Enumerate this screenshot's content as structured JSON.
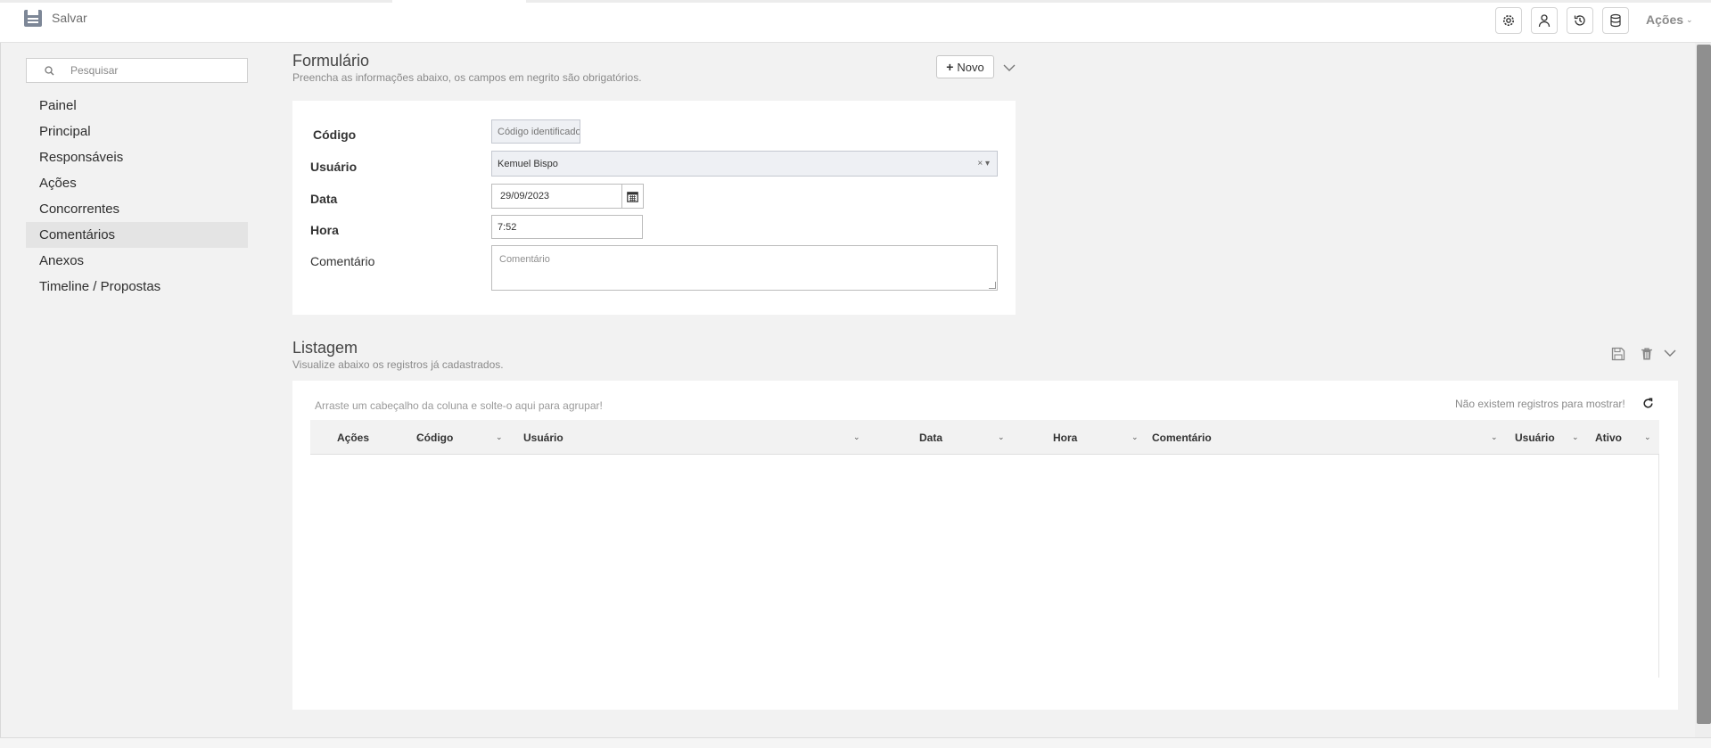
{
  "toolbar": {
    "save_label": "Salvar",
    "actions_label": "Ações",
    "icons": [
      "gear-icon",
      "user-icon",
      "history-icon",
      "database-icon"
    ]
  },
  "sidebar": {
    "search_placeholder": "Pesquisar",
    "items": [
      {
        "label": "Painel"
      },
      {
        "label": "Principal"
      },
      {
        "label": "Responsáveis"
      },
      {
        "label": "Ações"
      },
      {
        "label": "Concorrentes"
      },
      {
        "label": "Comentários",
        "active": true
      },
      {
        "label": "Anexos"
      },
      {
        "label": "Timeline / Propostas"
      }
    ]
  },
  "form": {
    "title": "Formulário",
    "subtitle": "Preencha as informações abaixo, os campos em negrito são obrigatórios.",
    "new_label": "Novo",
    "fields": {
      "codigo": {
        "label": "Código",
        "placeholder": "Código identificador"
      },
      "usuario": {
        "label": "Usuário",
        "value": "Kemuel Bispo"
      },
      "data": {
        "label": "Data",
        "value": "29/09/2023"
      },
      "hora": {
        "label": "Hora",
        "value": "7:52"
      },
      "comentario": {
        "label": "Comentário",
        "placeholder": "Comentário"
      }
    }
  },
  "listing": {
    "title": "Listagem",
    "subtitle": "Visualize abaixo os registros já cadastrados.",
    "group_hint": "Arraste um cabeçalho da coluna e solte-o aqui para agrupar!",
    "empty_message": "Não existem registros para mostrar!",
    "columns": [
      "Ações",
      "Código",
      "Usuário",
      "Data",
      "Hora",
      "Comentário",
      "Usuário",
      "Ativo"
    ]
  },
  "colors": {
    "active_nav": "#e4e4e4",
    "card_bg": "#ffffff",
    "page_bg": "#f2f2f2"
  }
}
